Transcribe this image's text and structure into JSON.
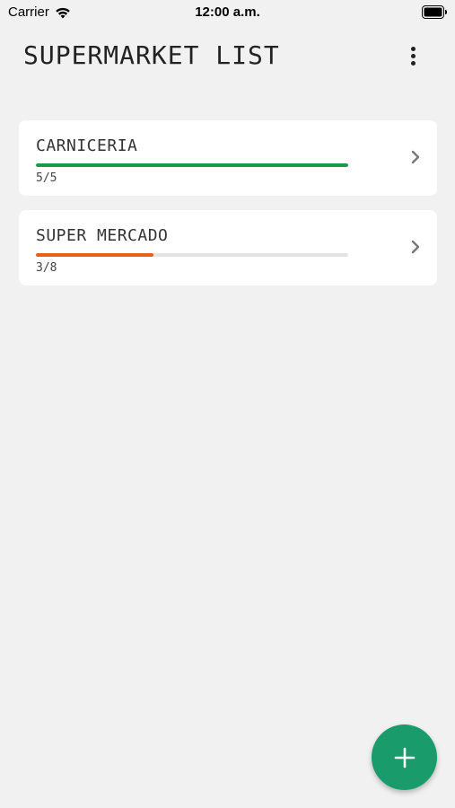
{
  "status_bar": {
    "carrier": "Carrier",
    "time": "12:00 a.m."
  },
  "header": {
    "title": "SUPERMARKET LIST"
  },
  "lists": [
    {
      "name": "CARNICERIA",
      "count_text": "5/5",
      "progress": 1.0,
      "color": "#1b9a4a"
    },
    {
      "name": "SUPER MERCADO",
      "count_text": "3/8",
      "progress": 0.375,
      "color": "#e8601c"
    }
  ],
  "icons": {
    "menu": "more-vertical-icon",
    "chevron": "chevron-right-icon",
    "add": "plus-icon"
  },
  "colors": {
    "background": "#f1f1f1",
    "card": "#ffffff",
    "fab": "#1a9b6c"
  }
}
